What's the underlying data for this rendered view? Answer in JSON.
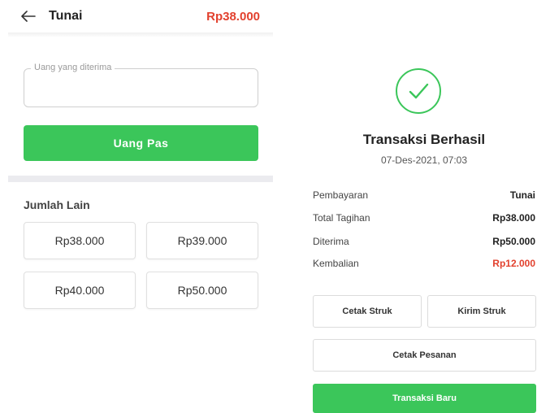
{
  "payment_screen": {
    "title": "Tunai",
    "total": "Rp38.000",
    "input_label": "Uang yang diterima",
    "input_value": "",
    "exact_button": "Uang Pas",
    "other_amount_label": "Jumlah Lain",
    "amounts": [
      "Rp38.000",
      "Rp39.000",
      "Rp40.000",
      "Rp50.000"
    ]
  },
  "success_screen": {
    "title": "Transaksi Berhasil",
    "datetime": "07-Des-2021, 07:03",
    "rows": [
      {
        "label": "Pembayaran",
        "value": "Tunai"
      },
      {
        "label": "Total Tagihan",
        "value": "Rp38.000"
      },
      {
        "label": "Diterima",
        "value": "Rp50.000"
      },
      {
        "label": "Kembalian",
        "value": "Rp12.000"
      }
    ],
    "print_receipt": "Cetak Struk",
    "send_receipt": "Kirim Struk",
    "print_order": "Cetak Pesanan",
    "new_transaction": "Transaksi Baru"
  },
  "colors": {
    "accent_green": "#3bc65a",
    "accent_red": "#e2412e"
  },
  "icons": {
    "back": "arrow-left-icon",
    "success": "check-circle-icon"
  }
}
